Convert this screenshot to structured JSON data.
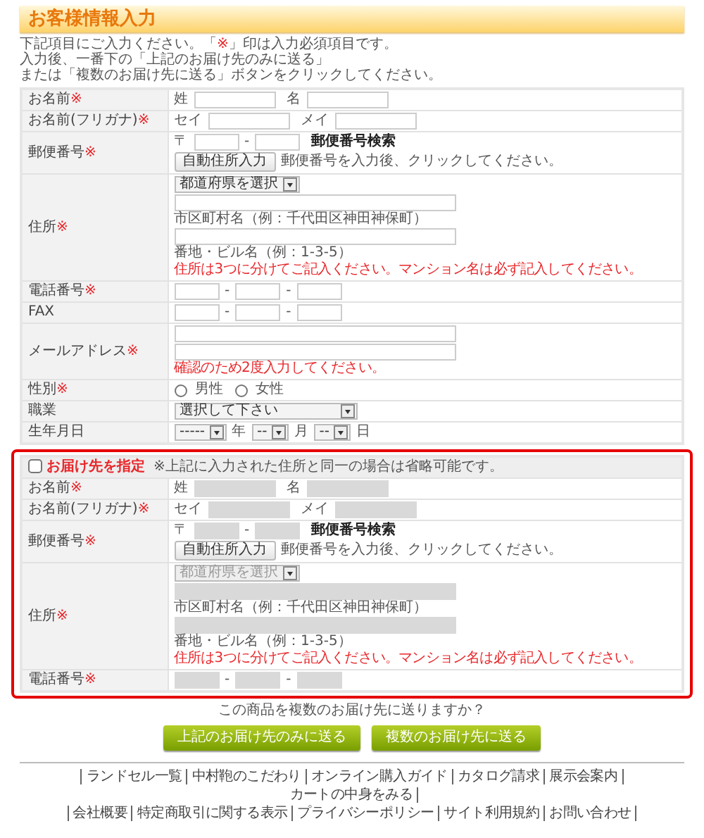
{
  "title": "お客様情報入力",
  "intro": [
    {
      "parts": [
        {
          "text": "下記項目にご入力ください。「"
        },
        {
          "text": "※",
          "kind": "required"
        },
        {
          "text": "」印は入力必須項目です。"
        }
      ]
    },
    {
      "parts": [
        {
          "text": "入力後、一番下の「上記のお届け先のみに送る」"
        }
      ]
    },
    {
      "parts": [
        {
          "text": "または「複数のお届け先に送る」ボタンをクリックしてください。"
        }
      ]
    }
  ],
  "customer": {
    "disabled": false,
    "rows": [
      {
        "kind": "name",
        "label": "お名前",
        "mark": "※",
        "prefixes": [
          "姓",
          "名"
        ]
      },
      {
        "kind": "name",
        "label": "お名前(フリガナ)",
        "mark": "※",
        "prefixes": [
          "セイ",
          "メイ"
        ]
      },
      {
        "kind": "postal",
        "label": "郵便番号",
        "mark": "※",
        "prefix": "〒",
        "separator": "-",
        "link": "郵便番号検索",
        "button": "自動住所入力",
        "hint": "郵便番号を入力後、クリックしてください。"
      },
      {
        "kind": "address",
        "label": "住所",
        "mark": "※",
        "select": "都道府県を選択",
        "captions": [
          "市区町村名（例：千代田区神田神保町）",
          "番地・ビル名（例：1-3-5）"
        ],
        "note": "住所は3つに分けてご記入ください。マンション名は必ず記入してください。"
      },
      {
        "kind": "phone",
        "label": "電話番号",
        "mark": "※",
        "separators": [
          "-",
          "-"
        ]
      },
      {
        "kind": "phone",
        "label": "FAX",
        "separators": [
          "-",
          "-"
        ]
      },
      {
        "kind": "email",
        "label": "メールアドレス",
        "mark": "※",
        "note": "確認のため2度入力してください。"
      },
      {
        "kind": "radio",
        "label": "性別",
        "mark": "※",
        "options": [
          {
            "label": "男性",
            "selected": false
          },
          {
            "label": "女性",
            "selected": false
          }
        ]
      },
      {
        "kind": "select",
        "label": "職業",
        "value": "選択して下さい"
      },
      {
        "kind": "date",
        "label": "生年月日",
        "parts": [
          {
            "value": "-----",
            "unit": "年"
          },
          {
            "value": "--",
            "unit": "月"
          },
          {
            "value": "--",
            "unit": "日"
          }
        ]
      }
    ]
  },
  "delivery": {
    "checkbox": {
      "label": "お届け先を指定",
      "checked": false
    },
    "note": "※上記に入力された住所と同一の場合は省略可能です。",
    "disabled": true,
    "rows": [
      {
        "kind": "name",
        "label": "お名前",
        "mark": "※",
        "prefixes": [
          "姓",
          "名"
        ]
      },
      {
        "kind": "name",
        "label": "お名前(フリガナ)",
        "mark": "※",
        "prefixes": [
          "セイ",
          "メイ"
        ]
      },
      {
        "kind": "postal",
        "label": "郵便番号",
        "mark": "※",
        "prefix": "〒",
        "separator": "-",
        "link": "郵便番号検索",
        "button": "自動住所入力",
        "hint": "郵便番号を入力後、クリックしてください。"
      },
      {
        "kind": "address",
        "label": "住所",
        "mark": "※",
        "select": "都道府県を選択",
        "captions": [
          "市区町村名（例：千代田区神田神保町）",
          "番地・ビル名（例：1-3-5）"
        ],
        "note": "住所は3つに分けてご記入ください。マンション名は必ず記入してください。"
      },
      {
        "kind": "phone",
        "label": "電話番号",
        "mark": "※",
        "separators": [
          "-",
          "-"
        ]
      }
    ]
  },
  "question": "この商品を複数のお届け先に送りますか？",
  "buttons": [
    "上記のお届け先のみに送る",
    "複数のお届け先に送る"
  ],
  "footer": [
    [
      "ランドセル一覧",
      "中村鞄のこだわり",
      "オンライン購入ガイド",
      "カタログ請求",
      "展示会案内",
      "カートの中身をみる"
    ],
    [
      "会社概要",
      "特定商取引に関する表示",
      "プライバシーポリシー",
      "サイト利用規約",
      "お問い合わせ"
    ]
  ]
}
